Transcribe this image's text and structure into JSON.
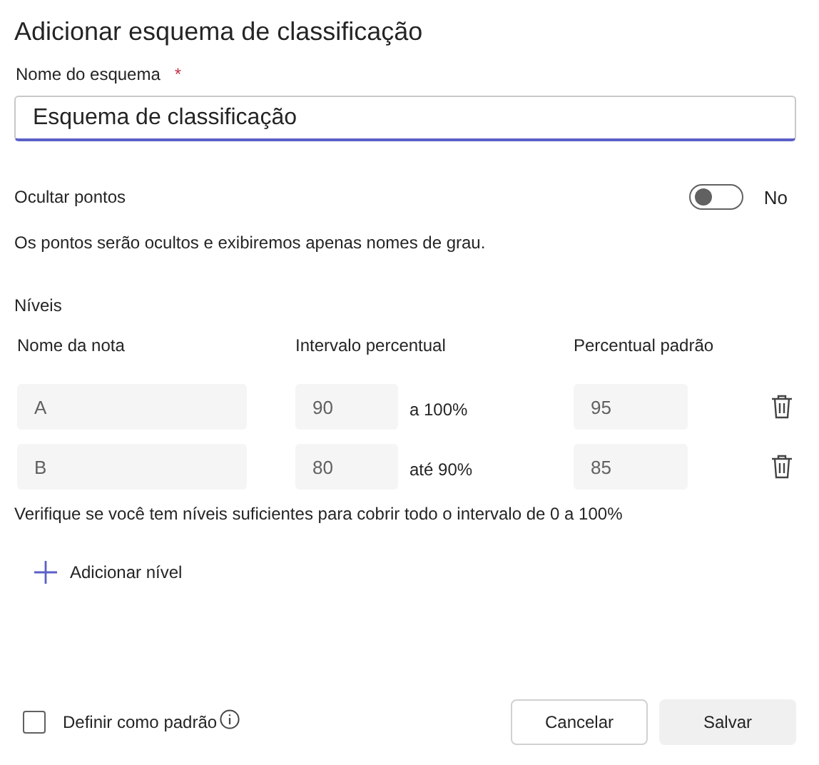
{
  "title": "Adicionar esquema de classificação",
  "name_field": {
    "label": "Nome do esquema",
    "required_mark": "*",
    "value": "Esquema de classificação"
  },
  "hide_points": {
    "label": "Ocultar pontos",
    "on": false,
    "state_text": "No",
    "description": "Os pontos serão ocultos e exibiremos apenas nomes de grau."
  },
  "levels": {
    "title": "Níveis",
    "columns": [
      "Nome da nota",
      "Intervalo percentual",
      "Percentual padrão"
    ],
    "rows": [
      {
        "name": "A",
        "min": "90",
        "range_text": "a 100%",
        "default": "95"
      },
      {
        "name": "B",
        "min": "80",
        "range_text": "até 90%",
        "default": "85"
      }
    ],
    "note": "Verifique se você tem níveis suficientes para cobrir todo o intervalo de 0 a 100%",
    "add_button": "Adicionar nível"
  },
  "set_default": {
    "label": "Definir como padrão",
    "checked": false
  },
  "buttons": [
    {
      "label": "Cancelar",
      "kind": "secondary"
    },
    {
      "label": "Salvar",
      "kind": "primary"
    }
  ]
}
